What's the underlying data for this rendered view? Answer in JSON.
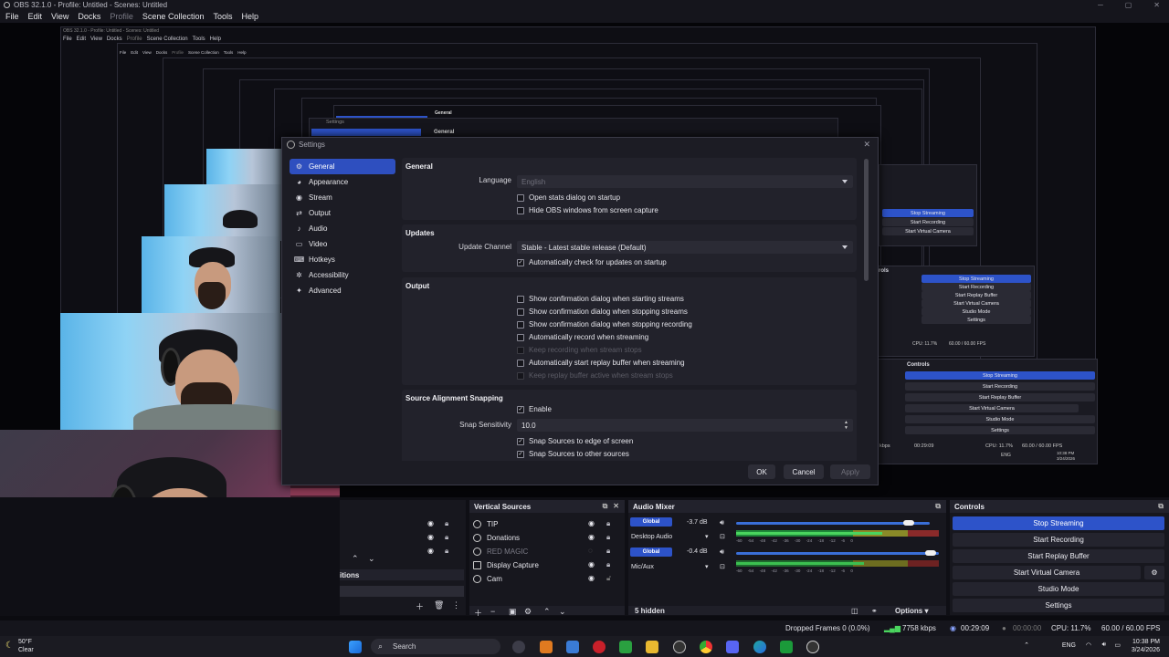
{
  "window": {
    "title": "OBS 32.1.0 - Profile: Untitled - Scenes: Untitled",
    "menu": [
      "File",
      "Edit",
      "View",
      "Docks",
      "Profile",
      "Scene Collection",
      "Tools",
      "Help"
    ],
    "min_icon": "minimize-icon",
    "max_icon": "maximize-icon",
    "close_icon": "close-icon"
  },
  "nested": {
    "title1": "OBS 32.1.0 - Profile: Untitled - Scenes: Untitled",
    "menu": [
      "File",
      "Edit",
      "View",
      "Docks",
      "Profile",
      "Scene Collection",
      "Tools",
      "Help"
    ],
    "settings_title": "Settings",
    "general": "General",
    "controls_title": "Controls",
    "controls": [
      "Stop Streaming",
      "Start Recording",
      "Start Replay Buffer",
      "Start Virtual Camera",
      "Studio Mode",
      "Settings"
    ],
    "status_time": "00:29:09",
    "status_cpu": "CPU: 11.7%",
    "status_fps": "60.00 / 60.00 FPS",
    "status_kbps": "kbps",
    "tray_lang": "ENG",
    "tray_time": "10:38 PM",
    "tray_date": "3/24/2026",
    "sub_controls_label": "rols"
  },
  "settings": {
    "title": "Settings",
    "nav": [
      {
        "label": "General",
        "icon": "gear-icon"
      },
      {
        "label": "Appearance",
        "icon": "palette-icon"
      },
      {
        "label": "Stream",
        "icon": "broadcast-icon"
      },
      {
        "label": "Output",
        "icon": "output-icon"
      },
      {
        "label": "Audio",
        "icon": "speaker-icon"
      },
      {
        "label": "Video",
        "icon": "monitor-icon"
      },
      {
        "label": "Hotkeys",
        "icon": "keyboard-icon"
      },
      {
        "label": "Accessibility",
        "icon": "accessibility-icon"
      },
      {
        "label": "Advanced",
        "icon": "wrench-icon"
      }
    ],
    "general": {
      "heading": "General",
      "language_label": "Language",
      "language_value": "English",
      "open_stats": "Open stats dialog on startup",
      "hide_obs": "Hide OBS windows from screen capture"
    },
    "updates": {
      "heading": "Updates",
      "channel_label": "Update Channel",
      "channel_value": "Stable - Latest stable release (Default)",
      "auto_check": "Automatically check for updates on startup"
    },
    "output": {
      "heading": "Output",
      "items": [
        {
          "label": "Show confirmation dialog when starting streams",
          "checked": false,
          "enabled": true
        },
        {
          "label": "Show confirmation dialog when stopping streams",
          "checked": false,
          "enabled": true
        },
        {
          "label": "Show confirmation dialog when stopping recording",
          "checked": false,
          "enabled": true
        },
        {
          "label": "Automatically record when streaming",
          "checked": false,
          "enabled": true
        },
        {
          "label": "Keep recording when stream stops",
          "checked": false,
          "enabled": false
        },
        {
          "label": "Automatically start replay buffer when streaming",
          "checked": false,
          "enabled": true
        },
        {
          "label": "Keep replay buffer active when stream stops",
          "checked": false,
          "enabled": false
        }
      ]
    },
    "snapping": {
      "heading": "Source Alignment Snapping",
      "enable": "Enable",
      "sensitivity_label": "Snap Sensitivity",
      "sensitivity_value": "10.0",
      "edge": "Snap Sources to edge of screen",
      "other": "Snap Sources to other sources"
    },
    "buttons": {
      "ok": "OK",
      "cancel": "Cancel",
      "apply": "Apply"
    }
  },
  "docks": {
    "scene_transitions_partial": "itions",
    "vertical_sources": {
      "title": "Vertical Sources",
      "items": [
        {
          "label": "TIP",
          "visible": true,
          "locked": true,
          "dimmed": false
        },
        {
          "label": "Donations",
          "visible": true,
          "locked": true,
          "dimmed": false
        },
        {
          "label": "RED MAGIC",
          "visible": false,
          "locked": true,
          "dimmed": true
        },
        {
          "label": "Display Capture",
          "visible": true,
          "locked": true,
          "dimmed": false
        },
        {
          "label": "Cam",
          "visible": true,
          "locked": false,
          "dimmed": false
        }
      ]
    },
    "audio_mixer": {
      "title": "Audio Mixer",
      "channels": [
        {
          "name": "Desktop Audio",
          "global": "Global",
          "db": "-3.7 dB",
          "volume_fraction": 0.9
        },
        {
          "name": "Mic/Aux",
          "global": "Global",
          "db": "-0.4 dB",
          "volume_fraction": 0.97
        }
      ],
      "ticks": [
        "-60",
        "-54",
        "-48",
        "-42",
        "-36",
        "-30",
        "-24",
        "-18",
        "-12",
        "-6",
        "0"
      ],
      "hidden": "5 hidden",
      "options": "Options"
    },
    "controls": {
      "title": "Controls",
      "buttons": [
        "Stop Streaming",
        "Start Recording",
        "Start Replay Buffer",
        "Start Virtual Camera",
        "Studio Mode",
        "Settings"
      ]
    }
  },
  "status": {
    "dropped": "Dropped Frames 0 (0.0%)",
    "kbps": "7758 kbps",
    "stream_time": "00:29:09",
    "rec_time": "00:00:00",
    "cpu": "CPU: 11.7%",
    "fps": "60.00 / 60.00 FPS"
  },
  "taskbar": {
    "weather_temp": "50°F",
    "weather_desc": "Clear",
    "search": "Search",
    "lang": "ENG",
    "time": "10:38 PM",
    "date": "3/24/2026"
  },
  "colors": {
    "accent": "#2d53c9",
    "panel": "#17171e",
    "background": "#0f0f15"
  }
}
